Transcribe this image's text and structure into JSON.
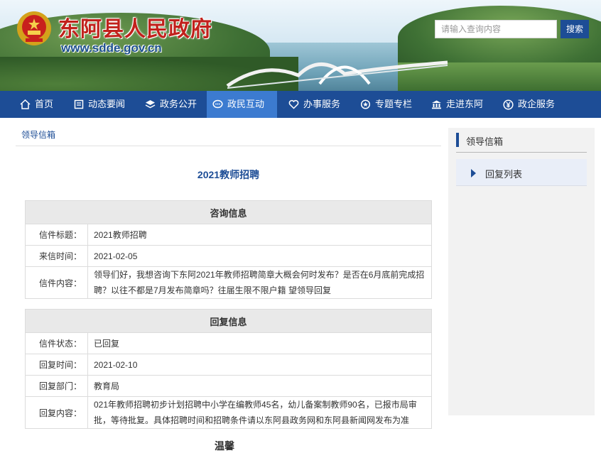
{
  "header": {
    "site_title": "东阿县人民政府",
    "site_url": "www.sdde.gov.cn",
    "search_placeholder": "请输入查询内容",
    "search_button": "搜索"
  },
  "nav": {
    "items": [
      {
        "label": "首页",
        "icon": "home-icon"
      },
      {
        "label": "动态要闻",
        "icon": "news-icon"
      },
      {
        "label": "政务公开",
        "icon": "layers-icon"
      },
      {
        "label": "政民互动",
        "icon": "chat-icon",
        "active": true
      },
      {
        "label": "办事服务",
        "icon": "heart-icon"
      },
      {
        "label": "专题专栏",
        "icon": "badge-icon"
      },
      {
        "label": "走进东阿",
        "icon": "building-icon"
      },
      {
        "label": "政企服务",
        "icon": "yen-icon"
      }
    ]
  },
  "breadcrumb": "领导信箱",
  "article": {
    "title": "2021教师招聘",
    "consult": {
      "heading": "咨询信息",
      "rows": [
        {
          "label": "信件标题：",
          "value": "2021教师招聘"
        },
        {
          "label": "来信时间：",
          "value": "2021-02-05"
        },
        {
          "label": "信件内容：",
          "value": "领导们好，我想咨询下东阿2021年教师招聘简章大概会何时发布？是否在6月底前完成招聘？以往不都是7月发布简章吗？往届生限不限户籍 望领导回复"
        }
      ]
    },
    "reply": {
      "heading": "回复信息",
      "rows": [
        {
          "label": "信件状态：",
          "value": "已回复"
        },
        {
          "label": "回复时间：",
          "value": "2021-02-10"
        },
        {
          "label": "回复部门：",
          "value": "教育局"
        },
        {
          "label": "回复内容：",
          "value": "021年教师招聘初步计划招聘中小学在编教师45名，幼儿备案制教师90名，已报市局审批，等待批复。具体招聘时间和招聘条件请以东阿县政务网和东阿县新闻网发布为准"
        }
      ]
    },
    "cut_text": "温馨"
  },
  "sidebar": {
    "title": "领导信箱",
    "items": [
      {
        "label": "回复列表"
      }
    ]
  }
}
